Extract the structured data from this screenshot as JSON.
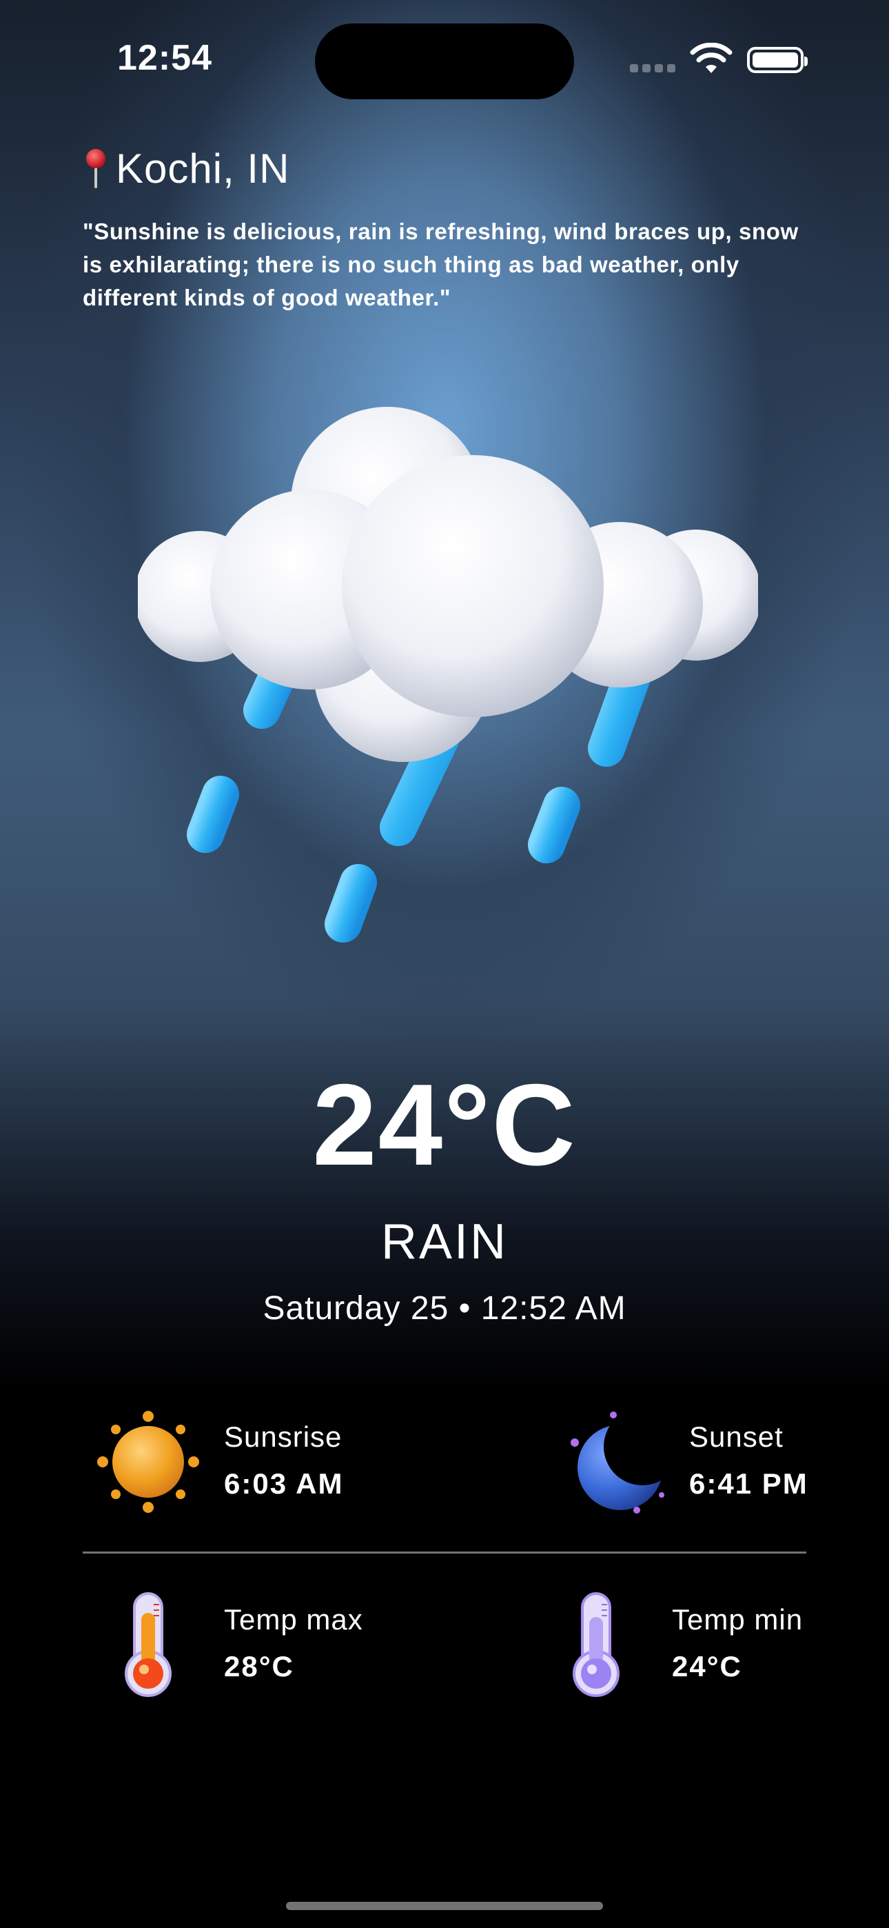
{
  "status_bar": {
    "time": "12:54",
    "icons": [
      "cellular-icon",
      "wifi-icon",
      "battery-icon"
    ]
  },
  "location": {
    "icon": "pin-icon",
    "label": "Kochi, IN"
  },
  "quote": "\"Sunshine is delicious, rain is refreshing, wind braces up, snow is exhilarating; there is no such thing as bad weather, only different kinds of good weather.\"",
  "illustration": "rain-cloud-icon",
  "current": {
    "temperature": "24°C",
    "condition": "RAIN",
    "datetime": "Saturday 25 • 12:52 AM"
  },
  "details": {
    "sunrise": {
      "icon": "sun-icon",
      "label": "Sunsrise",
      "value": "6:03 AM"
    },
    "sunset": {
      "icon": "moon-icon",
      "label": "Sunset",
      "value": "6:41 PM"
    },
    "temp_max": {
      "icon": "thermometer-hot-icon",
      "label": "Temp max",
      "value": "28°C"
    },
    "temp_min": {
      "icon": "thermometer-cold-icon",
      "label": "Temp min",
      "value": "24°C"
    }
  },
  "colors": {
    "accent_rain": "#2fb4f5",
    "sun_orange": "#f0a020",
    "moon_blue": "#3a6ad8",
    "thermo_purple": "#9c82f2"
  }
}
